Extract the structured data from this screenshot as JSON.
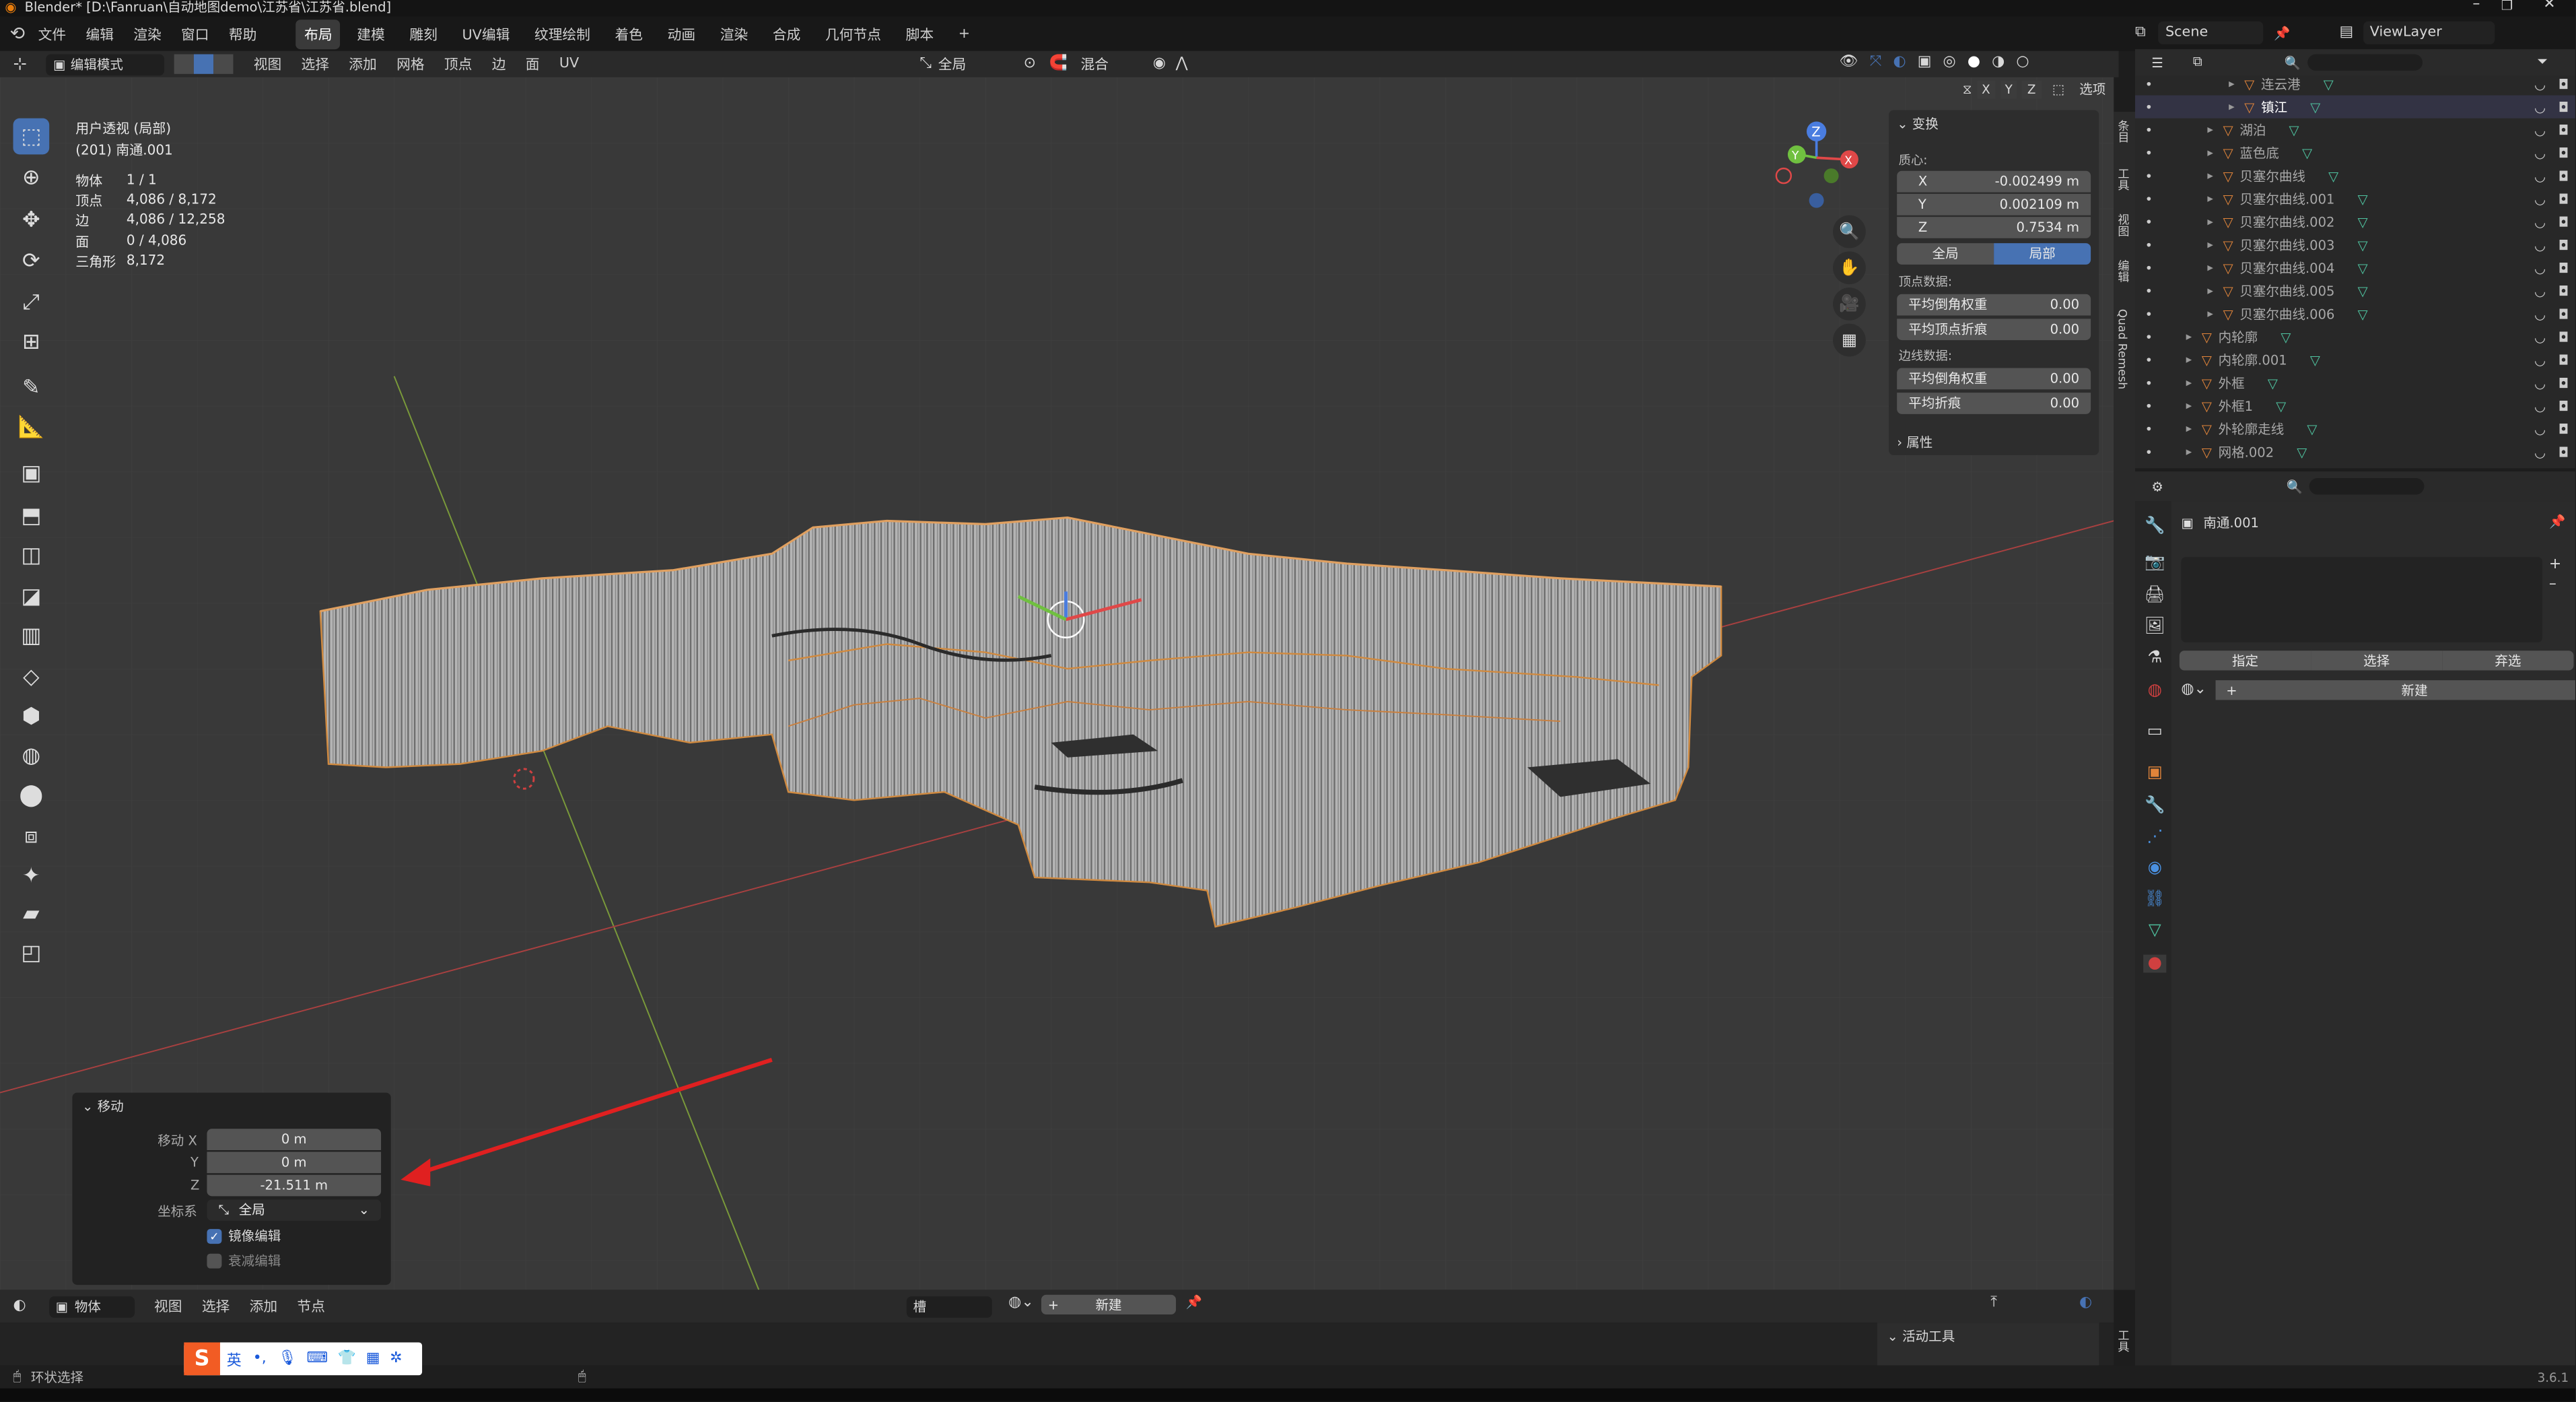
{
  "title_bar": {
    "text": "Blender* [D:\\Fanruan\\自动地图demo\\江苏省\\江苏省.blend]"
  },
  "menu": {
    "items": [
      "文件",
      "编辑",
      "渲染",
      "窗口",
      "帮助"
    ]
  },
  "workspaces": {
    "tabs": [
      "布局",
      "建模",
      "雕刻",
      "UV编辑",
      "纹理绘制",
      "着色",
      "动画",
      "渲染",
      "合成",
      "几何节点",
      "脚本"
    ],
    "add": "+"
  },
  "scene": {
    "label": "Scene",
    "view_layer": "ViewLayer"
  },
  "viewport_header": {
    "mode": "编辑模式",
    "menus": [
      "视图",
      "选择",
      "添加",
      "网格",
      "顶点",
      "边",
      "面",
      "UV"
    ],
    "orientation": "全局",
    "snap": "混合",
    "options": "选项",
    "axes": [
      "X",
      "Y",
      "Z"
    ]
  },
  "overlay": {
    "view_name": "用户透视 (局部)",
    "object_name": "(201) 南通.001",
    "stats": [
      {
        "label": "物体",
        "value": "1 / 1"
      },
      {
        "label": "顶点",
        "value": "4,086 / 8,172"
      },
      {
        "label": "边",
        "value": "4,086 / 12,258"
      },
      {
        "label": "面",
        "value": "0 / 4,086"
      },
      {
        "label": "三角形",
        "value": "8,172"
      }
    ]
  },
  "npanel": {
    "transform_header": "变换",
    "median_label": "质心:",
    "x_label": "X",
    "x_value": "-0.002499 m",
    "y_label": "Y",
    "y_value": "0.002109 m",
    "z_label": "Z",
    "z_value": "0.7534 m",
    "global_btn": "全局",
    "local_btn": "局部",
    "vertex_data": "顶点数据:",
    "mean_bevel_weight": "平均倒角权重",
    "mbw_value": "0.00",
    "mean_vertex_crease": "平均顶点折痕",
    "mvc_value": "0.00",
    "edge_data": "边线数据:",
    "edge_bevel_weight": "平均倒角权重",
    "ebw_value": "0.00",
    "mean_crease": "平均折痕",
    "mc_value": "0.00",
    "attributes_header": "属性",
    "tabs": [
      "条目",
      "工具",
      "视图",
      "编辑",
      "Quad Remesh"
    ]
  },
  "operator_panel": {
    "header": "移动",
    "move_x_label": "移动 X",
    "move_x": "0 m",
    "y_label": "Y",
    "move_y": "0 m",
    "z_label": "Z",
    "move_z": "-21.511 m",
    "coord_label": "坐标系",
    "coord_value": "全局",
    "mirror_label": "镜像编辑",
    "mirror_checked": true,
    "falloff_label": "衰减编辑",
    "falloff_checked": false
  },
  "bottom_header": {
    "mode": "物体",
    "menus": [
      "视图",
      "选择",
      "添加",
      "节点"
    ],
    "slot": "槽",
    "new_btn": "新建"
  },
  "active_tool": {
    "header": "活动工具",
    "tab": "工具"
  },
  "status": {
    "left": "环状选择",
    "ime_label": "英",
    "version": "3.6.1"
  },
  "outliner": {
    "rows": [
      {
        "name": "连云港",
        "indent": 3
      },
      {
        "name": "镇江",
        "indent": 3
      },
      {
        "name": "湖泊",
        "indent": 2
      },
      {
        "name": "蓝色底",
        "indent": 2
      },
      {
        "name": "贝塞尔曲线",
        "indent": 2
      },
      {
        "name": "贝塞尔曲线.001",
        "indent": 2
      },
      {
        "name": "贝塞尔曲线.002",
        "indent": 2
      },
      {
        "name": "贝塞尔曲线.003",
        "indent": 2
      },
      {
        "name": "贝塞尔曲线.004",
        "indent": 2
      },
      {
        "name": "贝塞尔曲线.005",
        "indent": 2
      },
      {
        "name": "贝塞尔曲线.006",
        "indent": 2
      },
      {
        "name": "内轮廓",
        "indent": 1
      },
      {
        "name": "内轮廓.001",
        "indent": 1
      },
      {
        "name": "外框",
        "indent": 1
      },
      {
        "name": "外框1",
        "indent": 1
      },
      {
        "name": "外轮廓走线",
        "indent": 1
      },
      {
        "name": "网格.002",
        "indent": 1
      }
    ]
  },
  "properties": {
    "object_name": "南通.001",
    "assign_btn": "指定",
    "select_btn": "选择",
    "deselect_btn": "弃选",
    "new_btn": "新建"
  },
  "colors": {
    "accent": "#4772b3",
    "viewport_bg": "#393939",
    "orange": "#e0843a",
    "mesh_green": "#4fc3a0",
    "arrow_red": "#e02020"
  }
}
